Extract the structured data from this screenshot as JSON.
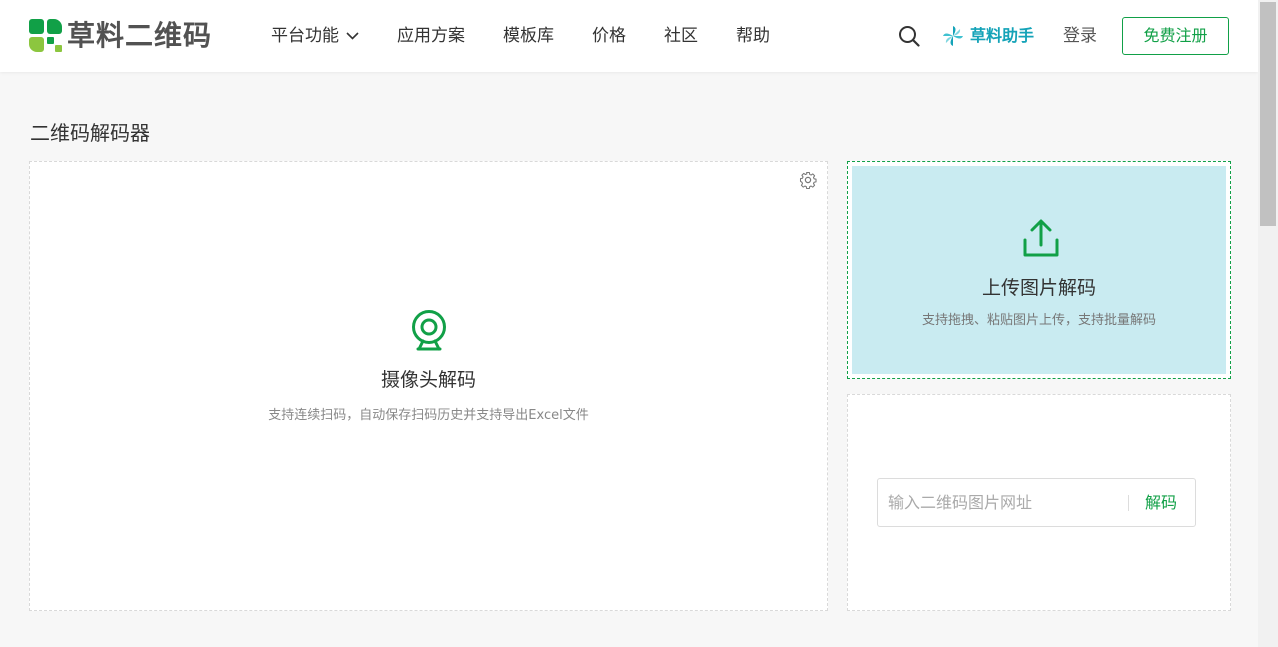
{
  "header": {
    "logo_text": "草料二维码",
    "nav": [
      {
        "label": "平台功能",
        "has_dropdown": true
      },
      {
        "label": "应用方案"
      },
      {
        "label": "模板库"
      },
      {
        "label": "价格"
      },
      {
        "label": "社区"
      },
      {
        "label": "帮助"
      }
    ],
    "assistant_label": "草料助手",
    "login_label": "登录",
    "signup_label": "免费注册"
  },
  "main": {
    "title": "二维码解码器",
    "camera": {
      "title": "摄像头解码",
      "description": "支持连续扫码，自动保存扫码历史并支持导出Excel文件"
    },
    "upload": {
      "title": "上传图片解码",
      "description": "支持拖拽、粘贴图片上传，支持批量解码"
    },
    "url": {
      "placeholder": "输入二维码图片网址",
      "value": "",
      "decode_label": "解码"
    }
  },
  "colors": {
    "brand_green": "#11a047",
    "assistant_teal": "#14a3b8",
    "upload_bg": "#c9ebf1"
  },
  "icons": [
    "logo-icon",
    "chevron-down-icon",
    "search-icon",
    "assistant-pinwheel-icon",
    "gear-icon",
    "webcam-icon",
    "upload-icon"
  ]
}
